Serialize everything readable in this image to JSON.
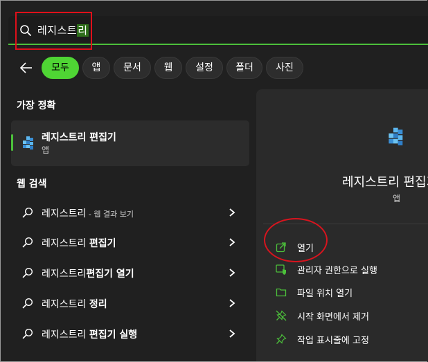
{
  "search": {
    "query_prefix": "레지스트",
    "query_selected": "리"
  },
  "filters": [
    "모두",
    "앱",
    "문서",
    "웹",
    "설정",
    "폴더",
    "사진"
  ],
  "active_filter": "모두",
  "best_match": {
    "heading": "가장 정확",
    "title": "레지스트리 편집기",
    "subtitle": "앱"
  },
  "web_search": {
    "heading": "웹 검색",
    "items": [
      {
        "prefix": "레지스트리",
        "bold": "",
        "suffix": " - 웹 결과 보기"
      },
      {
        "prefix": "레지스트리 ",
        "bold": "편집기",
        "suffix": ""
      },
      {
        "prefix": "레지스트리",
        "bold": "편집기 열기",
        "suffix": ""
      },
      {
        "prefix": "레지스트리 ",
        "bold": "정리",
        "suffix": ""
      },
      {
        "prefix": "레지스트리 ",
        "bold": "편집기 실행",
        "suffix": ""
      }
    ]
  },
  "details": {
    "title": "레지스트리 편집기",
    "subtitle": "앱",
    "actions": [
      {
        "label": "열기",
        "icon": "open-external-icon"
      },
      {
        "label": "관리자 권한으로 실행",
        "icon": "admin-shield-icon"
      },
      {
        "label": "파일 위치 열기",
        "icon": "folder-icon"
      },
      {
        "label": "시작 화면에서 제거",
        "icon": "unpin-icon"
      },
      {
        "label": "작업 표시줄에 고정",
        "icon": "pin-icon"
      }
    ]
  },
  "colors": {
    "accent": "#4cc03b",
    "annotation_red": "#e0101a",
    "background": "#202020",
    "panel": "#2a2a2a"
  }
}
